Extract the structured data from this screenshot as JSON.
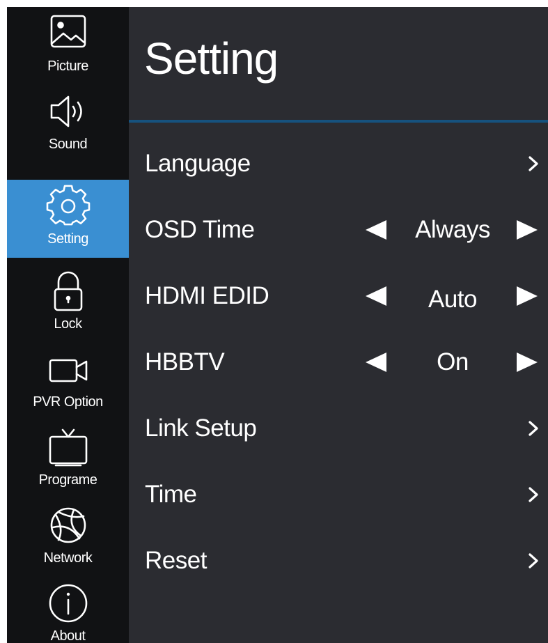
{
  "sidebar": {
    "items": [
      {
        "label": "Picture",
        "icon": "picture-icon"
      },
      {
        "label": "Sound",
        "icon": "speaker-icon"
      },
      {
        "label": "Setting",
        "icon": "gear-icon",
        "active": true
      },
      {
        "label": "Lock",
        "icon": "padlock-icon"
      },
      {
        "label": "PVR Option",
        "icon": "video-camera-icon"
      },
      {
        "label": "Programe",
        "icon": "tv-icon"
      },
      {
        "label": "Network",
        "icon": "globe-icon"
      },
      {
        "label": "About",
        "icon": "info-icon"
      }
    ]
  },
  "main": {
    "title": "Setting",
    "rows": [
      {
        "label": "Language",
        "type": "submenu"
      },
      {
        "label": "OSD Time",
        "type": "selector",
        "value": "Always"
      },
      {
        "label": "HDMI EDID",
        "type": "selector",
        "value": "Auto"
      },
      {
        "label": "HBBTV",
        "type": "selector",
        "value": "On"
      },
      {
        "label": "Link Setup",
        "type": "submenu"
      },
      {
        "label": "Time",
        "type": "submenu"
      },
      {
        "label": "Reset",
        "type": "submenu"
      }
    ]
  },
  "colors": {
    "sidebar_bg": "#111214",
    "main_bg": "#2b2c31",
    "active_bg": "#3a8fd2",
    "title_rule": "#16527e",
    "text": "#ffffff"
  }
}
